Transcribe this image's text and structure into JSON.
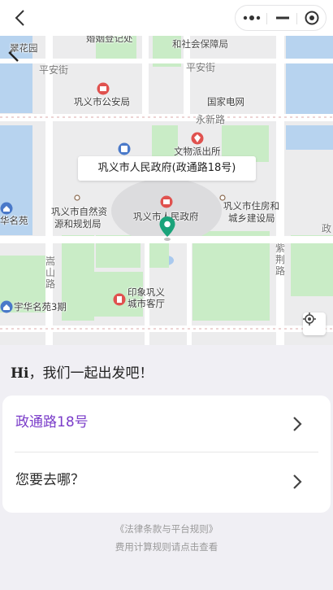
{
  "map": {
    "labels": {
      "top_left_cut": "翠花园",
      "top_mid_cut": "婚姻登记处",
      "top_right_cut": "和社会保障局",
      "pingan_left": "平安街",
      "pingan_right": "平安街",
      "police": "巩义市公安局",
      "grid": "国家电网",
      "yongxin": "永新路",
      "wenwu": "文物派出所",
      "ziran": "巩义市自然资源和规划局",
      "ziran_l1": "巩义市自然资",
      "ziran_l2": "源和规划局",
      "gov": "巩义市人民政府",
      "housing_l1": "巩义市住房和",
      "housing_l2": "城乡建设局",
      "zheng": "政",
      "huaming": "华名苑",
      "songshan_1": "嵩",
      "songshan_2": "山",
      "songshan_3": "路",
      "zijing_1": "紫",
      "zijing_2": "荆",
      "zijing_3": "路",
      "yinxiang_l1": "印象巩义",
      "yinxiang_l2": "城市客厅",
      "yuhua": "宇华名苑3期"
    },
    "callout": "巩义市人民政府(政通路18号)"
  },
  "panel": {
    "greeting_hi": "Hi",
    "greeting_text": "，我们一起出发吧！",
    "origin": "政通路18号",
    "destination_placeholder": "您要去哪？",
    "footer_link": "《法律条款与平台规则》",
    "footer_note": "费用计算规则请点击查看"
  },
  "colors": {
    "accent": "#7a3cc9",
    "pin": "#1aa37a",
    "poi_red": "#e0524f",
    "poi_blue": "#4a79c9",
    "water": "#b7d3ef",
    "green": "#c9ecc6"
  },
  "icons": [
    "back-arrow-icon",
    "more-dots-icon",
    "minimize-icon",
    "close-target-icon",
    "location-pin-icon",
    "locate-icon",
    "chevron-right-icon"
  ]
}
